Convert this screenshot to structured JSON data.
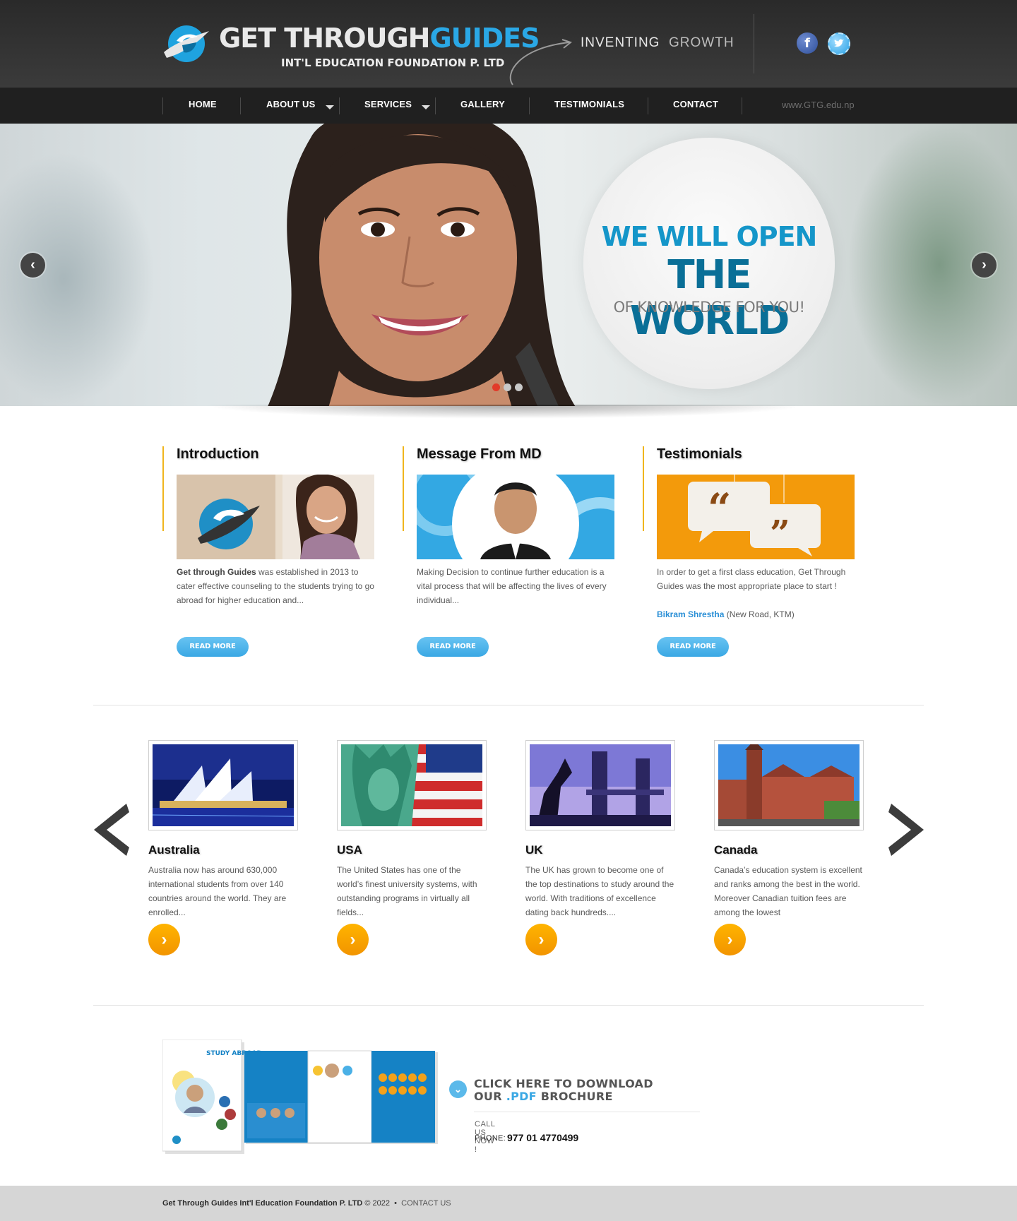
{
  "header": {
    "logo_main": "GET THROUGH",
    "logo_accent": "GUIDES",
    "logo_sub": "INT'L EDUCATION FOUNDATION P. LTD",
    "tagline_a": "INVENTING",
    "tagline_b": "GROWTH",
    "social": [
      {
        "name": "facebook-icon",
        "glyph": "f"
      },
      {
        "name": "twitter-icon",
        "glyph": "t"
      }
    ]
  },
  "nav": {
    "items": [
      "HOME",
      "ABOUT US",
      "SERVICES",
      "GALLERY",
      "TESTIMONIALS",
      "CONTACT"
    ],
    "url": "www.GTG.edu.np"
  },
  "hero": {
    "line1": "WE WILL OPEN",
    "line2": "THE WORLD",
    "line3": "OF KNOWLEDGE FOR YOU!",
    "prev_glyph": "‹",
    "next_glyph": "›",
    "slides": 3,
    "active_slide": 1
  },
  "cards": [
    {
      "title": "Introduction",
      "bold": "Get through Guides",
      "text": " was established in 2013 to cater effective counseling to the students trying to go abroad for higher education and...",
      "button": "READ MORE"
    },
    {
      "title": "Message From MD",
      "text": "Making Decision to continue further education is a vital process that will be affecting the lives of every individual...",
      "button": "READ MORE"
    },
    {
      "title": "Testimonials",
      "text": "In order to get a first class education, Get Through Guides was the most appropriate place to start !",
      "author": "Bikram Shrestha",
      "author_loc": " (New Road, KTM)",
      "button": "READ MORE"
    }
  ],
  "countries": [
    {
      "title": "Australia",
      "text": "Australia now has around 630,000 international students from over 140 countries around the world. They are enrolled..."
    },
    {
      "title": "USA",
      "text": "The United States has one of the world’s finest university systems, with outstanding programs in virtually all fields..."
    },
    {
      "title": "UK",
      "text": "The UK has grown to become one of the top destinations to study around the world. With traditions of excellence dating back hundreds...."
    },
    {
      "title": "Canada",
      "text": "Canada’s education system is excellent and ranks among the best in the world. Moreover Canadian tuition fees are among the lowest"
    }
  ],
  "brochure": {
    "line1": "CLICK HERE TO DOWNLOAD",
    "line2_a": "OUR ",
    "line2_pdf": ".PDF",
    "line2_b": " BROCHURE",
    "call": "CALL US NOW !",
    "phone_label": "PHONE:",
    "phone": "977 01 4770499",
    "cover_title": "STUDY ABROAD"
  },
  "footer": {
    "company": "Get Through Guides Int'l Education Foundation P. LTD",
    "copyright": "© 2022",
    "sep": "•",
    "link": "CONTACT US"
  },
  "colors": {
    "accent_blue": "#2aa8e6",
    "accent_orange": "#f29400",
    "accent_yellow": "#f0b51d"
  }
}
